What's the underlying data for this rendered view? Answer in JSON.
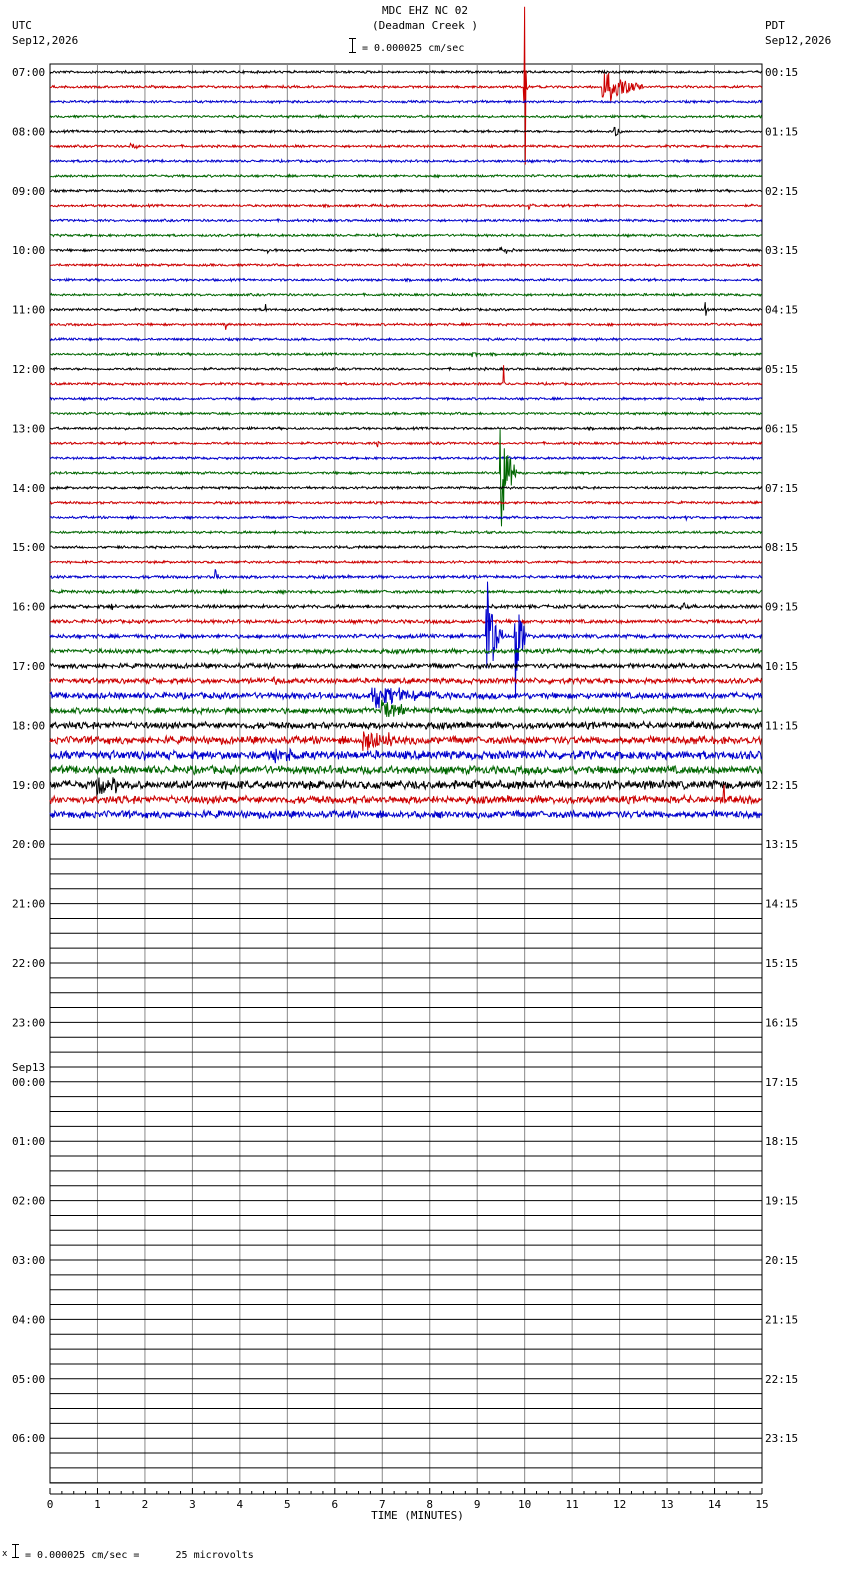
{
  "header": {
    "title": "MDC EHZ NC 02",
    "subtitle": "(Deadman Creek )",
    "scale_label": "= 0.000025 cm/sec",
    "left_tz": "UTC",
    "left_date": "Sep12,2026",
    "right_tz": "PDT",
    "right_date": "Sep12,2026"
  },
  "footer": {
    "scale_note": "= 0.000025 cm/sec =      25 microvolts",
    "corner_mark": "x"
  },
  "chart_data": {
    "type": "line",
    "title": "MDC EHZ NC 02",
    "subtitle": "(Deadman Creek )",
    "xlabel": "TIME (MINUTES)",
    "ylabel": "",
    "xlim": [
      0,
      15
    ],
    "x_ticks": [
      "0",
      "1",
      "2",
      "3",
      "4",
      "5",
      "6",
      "7",
      "8",
      "9",
      "10",
      "11",
      "12",
      "13",
      "14",
      "15"
    ],
    "trace_minutes": 15,
    "traces_per_hour": 4,
    "total_traces": 96,
    "recorded_traces": 51,
    "trace_colors": [
      "#000000",
      "#cc0000",
      "#0000cc",
      "#006600"
    ],
    "grid": true,
    "left_labels": [
      {
        "trace": 0,
        "text": "07:00"
      },
      {
        "trace": 4,
        "text": "08:00"
      },
      {
        "trace": 8,
        "text": "09:00"
      },
      {
        "trace": 12,
        "text": "10:00"
      },
      {
        "trace": 16,
        "text": "11:00"
      },
      {
        "trace": 20,
        "text": "12:00"
      },
      {
        "trace": 24,
        "text": "13:00"
      },
      {
        "trace": 28,
        "text": "14:00"
      },
      {
        "trace": 32,
        "text": "15:00"
      },
      {
        "trace": 36,
        "text": "16:00"
      },
      {
        "trace": 40,
        "text": "17:00"
      },
      {
        "trace": 44,
        "text": "18:00"
      },
      {
        "trace": 48,
        "text": "19:00"
      },
      {
        "trace": 52,
        "text": "20:00"
      },
      {
        "trace": 56,
        "text": "21:00"
      },
      {
        "trace": 60,
        "text": "22:00"
      },
      {
        "trace": 64,
        "text": "23:00"
      },
      {
        "trace": 68,
        "text": "00:00",
        "date": "Sep13"
      },
      {
        "trace": 72,
        "text": "01:00"
      },
      {
        "trace": 76,
        "text": "02:00"
      },
      {
        "trace": 80,
        "text": "03:00"
      },
      {
        "trace": 84,
        "text": "04:00"
      },
      {
        "trace": 88,
        "text": "05:00"
      },
      {
        "trace": 92,
        "text": "06:00"
      }
    ],
    "right_labels": [
      {
        "trace": 0,
        "text": "00:15"
      },
      {
        "trace": 4,
        "text": "01:15"
      },
      {
        "trace": 8,
        "text": "02:15"
      },
      {
        "trace": 12,
        "text": "03:15"
      },
      {
        "trace": 16,
        "text": "04:15"
      },
      {
        "trace": 20,
        "text": "05:15"
      },
      {
        "trace": 24,
        "text": "06:15"
      },
      {
        "trace": 28,
        "text": "07:15"
      },
      {
        "trace": 32,
        "text": "08:15"
      },
      {
        "trace": 36,
        "text": "09:15"
      },
      {
        "trace": 40,
        "text": "10:15"
      },
      {
        "trace": 44,
        "text": "11:15"
      },
      {
        "trace": 48,
        "text": "12:15"
      },
      {
        "trace": 52,
        "text": "13:15"
      },
      {
        "trace": 56,
        "text": "14:15"
      },
      {
        "trace": 60,
        "text": "15:15"
      },
      {
        "trace": 64,
        "text": "16:15"
      },
      {
        "trace": 68,
        "text": "17:15"
      },
      {
        "trace": 72,
        "text": "18:15"
      },
      {
        "trace": 76,
        "text": "19:15"
      },
      {
        "trace": 80,
        "text": "20:15"
      },
      {
        "trace": 84,
        "text": "21:15"
      },
      {
        "trace": 88,
        "text": "22:15"
      },
      {
        "trace": 92,
        "text": "23:15"
      }
    ],
    "noise_by_trace": [
      1,
      1,
      1,
      1,
      1,
      1,
      1,
      1,
      1,
      1,
      1,
      1,
      1,
      1,
      1,
      1,
      1,
      1,
      1,
      1,
      1,
      1,
      1,
      1,
      1,
      1,
      1,
      1,
      1,
      1,
      1,
      1,
      1,
      1,
      1.2,
      1.3,
      1.4,
      1.5,
      1.6,
      1.8,
      2,
      2.2,
      2.6,
      2.4,
      2.8,
      3.2,
      3.6,
      3.4,
      3.6,
      3.2,
      3
    ],
    "events": [
      {
        "trace": 1,
        "minute": 11.65,
        "amp": 22,
        "dur": 0.8
      },
      {
        "trace": 3,
        "minute": 5.7,
        "amp": 40,
        "dur": 0.05
      },
      {
        "trace": 4,
        "minute": 11.9,
        "amp": 7,
        "dur": 0.2
      },
      {
        "trace": 5,
        "minute": 1.7,
        "amp": 4,
        "dur": 0.3
      },
      {
        "trace": 1,
        "minute": 10.0,
        "amp": 260,
        "dur": 0.03
      },
      {
        "trace": 9,
        "minute": 10.1,
        "amp": 8,
        "dur": 0.1
      },
      {
        "trace": 12,
        "minute": 4.6,
        "amp": 7,
        "dur": 0.05
      },
      {
        "trace": 12,
        "minute": 9.5,
        "amp": 4,
        "dur": 0.4
      },
      {
        "trace": 16,
        "minute": 4.55,
        "amp": 18,
        "dur": 0.05
      },
      {
        "trace": 16,
        "minute": 13.8,
        "amp": 36,
        "dur": 0.05
      },
      {
        "trace": 17,
        "minute": 3.7,
        "amp": 7,
        "dur": 0.05
      },
      {
        "trace": 19,
        "minute": 8.9,
        "amp": 4,
        "dur": 0.2
      },
      {
        "trace": 21,
        "minute": 9.55,
        "amp": 38,
        "dur": 0.05
      },
      {
        "trace": 25,
        "minute": 6.9,
        "amp": 10,
        "dur": 0.05
      },
      {
        "trace": 27,
        "minute": 9.5,
        "amp": 60,
        "dur": 0.3
      },
      {
        "trace": 30,
        "minute": 13.4,
        "amp": 5,
        "dur": 0.05
      },
      {
        "trace": 34,
        "minute": 3.5,
        "amp": 9,
        "dur": 0.1
      },
      {
        "trace": 36,
        "minute": 1.3,
        "amp": 10,
        "dur": 0.05
      },
      {
        "trace": 36,
        "minute": 13.3,
        "amp": 5,
        "dur": 0.3
      },
      {
        "trace": 38,
        "minute": 9.2,
        "amp": 70,
        "dur": 0.3
      },
      {
        "trace": 38,
        "minute": 9.8,
        "amp": 80,
        "dur": 0.2
      },
      {
        "trace": 41,
        "minute": 4.7,
        "amp": 10,
        "dur": 0.1
      },
      {
        "trace": 42,
        "minute": 6.8,
        "amp": 14,
        "dur": 1.4
      },
      {
        "trace": 43,
        "minute": 7.0,
        "amp": 16,
        "dur": 0.6
      },
      {
        "trace": 45,
        "minute": 6.6,
        "amp": 14,
        "dur": 1.0
      },
      {
        "trace": 46,
        "minute": 4.7,
        "amp": 10,
        "dur": 0.5
      },
      {
        "trace": 48,
        "minute": 1.0,
        "amp": 12,
        "dur": 0.8
      },
      {
        "trace": 49,
        "minute": 14.2,
        "amp": 30,
        "dur": 0.05
      }
    ]
  }
}
